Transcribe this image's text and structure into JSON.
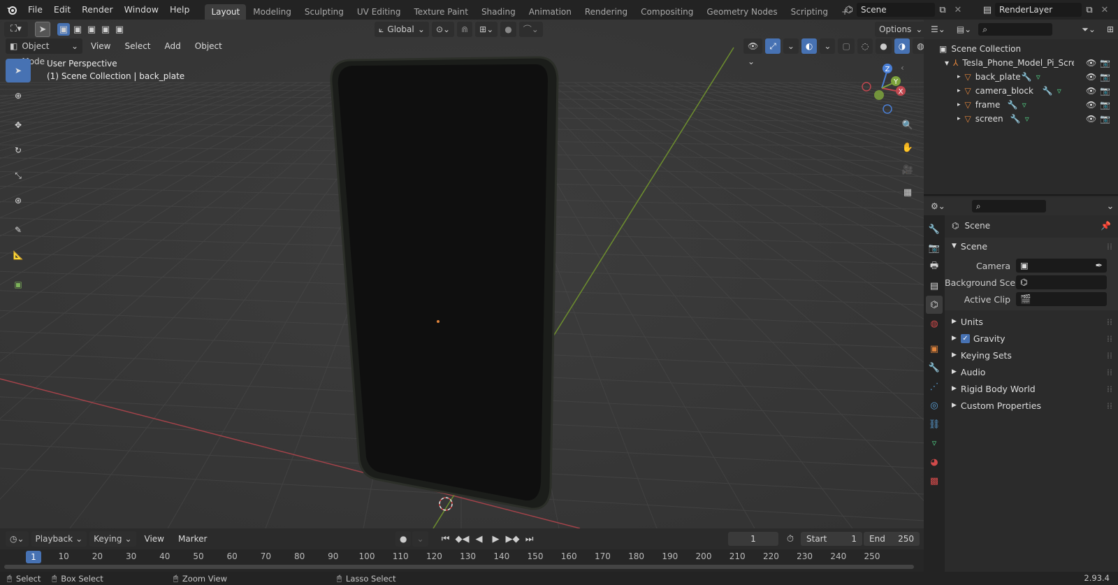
{
  "menu": {
    "file": "File",
    "edit": "Edit",
    "render": "Render",
    "window": "Window",
    "help": "Help"
  },
  "workspaces": [
    "Layout",
    "Modeling",
    "Sculpting",
    "UV Editing",
    "Texture Paint",
    "Shading",
    "Animation",
    "Rendering",
    "Compositing",
    "Geometry Nodes",
    "Scripting"
  ],
  "scene_name": "Scene",
  "view_layer": "RenderLayer",
  "viewport": {
    "orientation": "Global",
    "options": "Options",
    "mode": "Object Mode",
    "view": "View",
    "select": "Select",
    "add": "Add",
    "object": "Object",
    "perspective": "User Perspective",
    "collection_info": "(1) Scene Collection | back_plate",
    "gizmo": {
      "x": "X",
      "y": "Y",
      "z": "Z"
    }
  },
  "outliner": {
    "root": "Scene Collection",
    "collection": "Tesla_Phone_Model_Pi_Screen",
    "objects": [
      "back_plate",
      "camera_block",
      "frame",
      "screen"
    ]
  },
  "properties": {
    "header": "Scene",
    "section": "Scene",
    "camera_label": "Camera",
    "background_label": "Background Sce...",
    "clip_label": "Active Clip",
    "subsections": [
      "Units",
      "Gravity",
      "Keying Sets",
      "Audio",
      "Rigid Body World",
      "Custom Properties"
    ],
    "gravity_checked": true
  },
  "timeline": {
    "playback": "Playback",
    "keying": "Keying",
    "view": "View",
    "marker": "Marker",
    "current_frame": "1",
    "start_label": "Start",
    "start": "1",
    "end_label": "End",
    "end": "250",
    "ticks": [
      "10",
      "20",
      "30",
      "40",
      "50",
      "60",
      "70",
      "80",
      "90",
      "100",
      "110",
      "120",
      "130",
      "140",
      "150",
      "160",
      "170",
      "180",
      "190",
      "200",
      "210",
      "220",
      "230",
      "240",
      "250"
    ],
    "playhead": "1"
  },
  "status": {
    "select": "Select",
    "box_select": "Box Select",
    "zoom_view": "Zoom View",
    "lasso_select": "Lasso Select",
    "version": "2.93.4"
  },
  "colors": {
    "accent": "#4772b3",
    "x_axis": "#c0474f",
    "y_axis": "#7da33c",
    "z_axis": "#4a7fd6",
    "object_orange": "#e0843c"
  }
}
